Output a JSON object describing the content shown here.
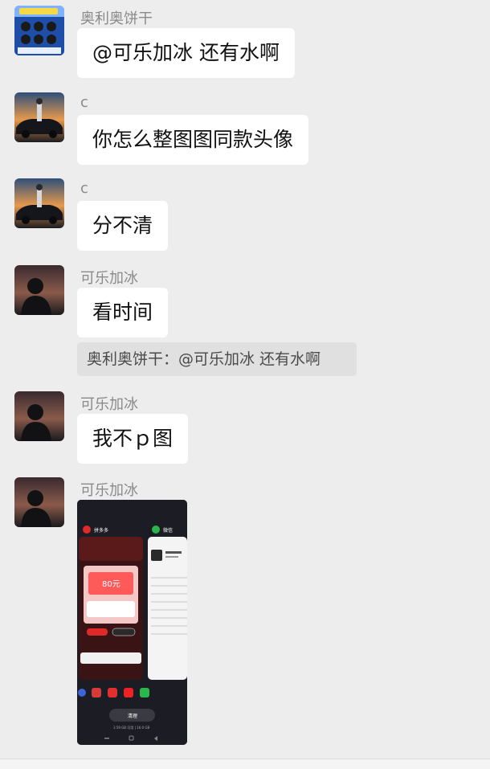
{
  "messages": [
    {
      "sender": "奥利奥饼干",
      "text": "@可乐加冰  还有水啊"
    },
    {
      "sender": "c",
      "text": "你怎么整图图同款头像"
    },
    {
      "sender": "c",
      "text": "分不清"
    },
    {
      "sender": "可乐加冰",
      "text": "看时间",
      "quote": "奥利奥饼干：@可乐加冰 还有水啊"
    },
    {
      "sender": "可乐加冰",
      "text": "我不ｐ图"
    },
    {
      "sender": "可乐加冰",
      "image": "phone-multitask-screenshot"
    }
  ],
  "shared_screenshot": {
    "app1_name": "拼多多",
    "app2_name": "微信",
    "price": "80元",
    "clear_button": "清理",
    "memory_text": "3.59 GB 可用 | 16.0 GB"
  }
}
